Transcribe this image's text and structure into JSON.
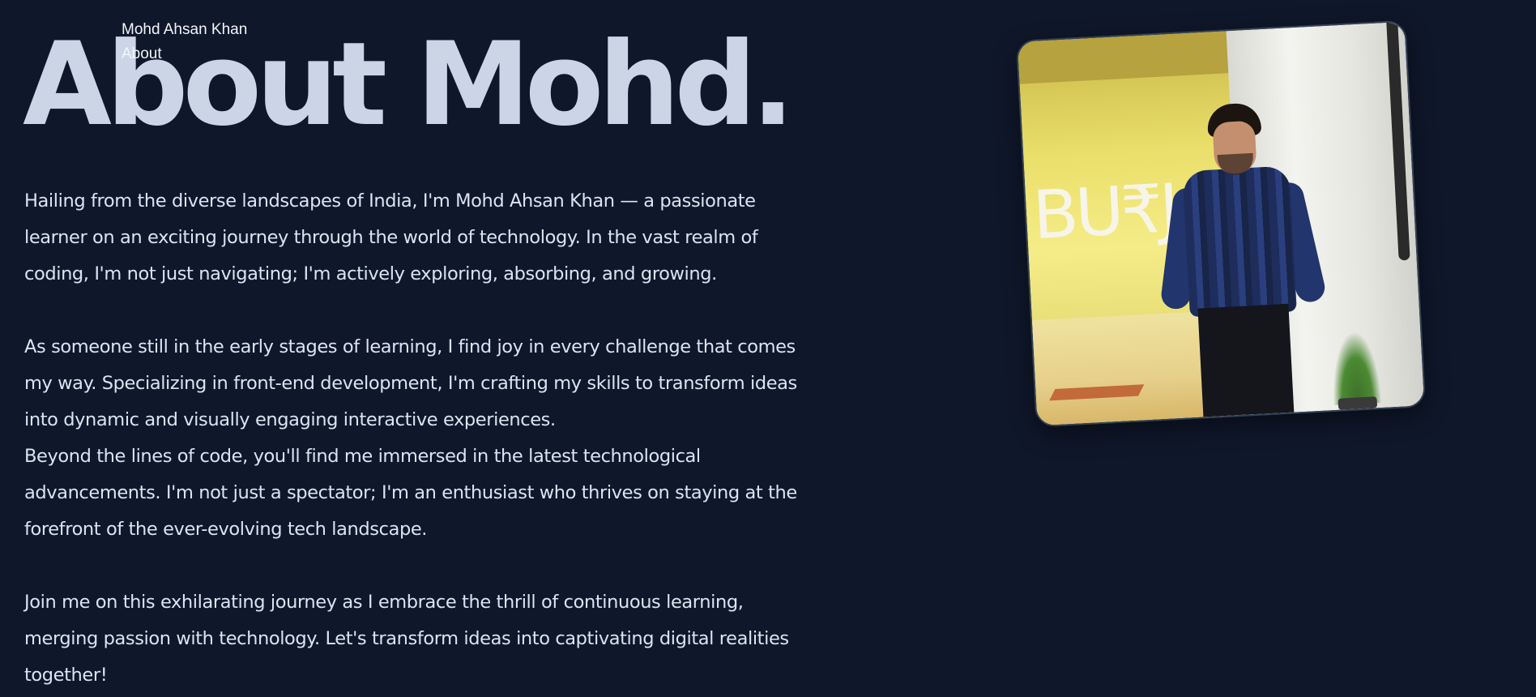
{
  "nav": {
    "brand": "Mohd Ahsan Khan",
    "link_about": "About"
  },
  "hero": {
    "title": "About Mohd."
  },
  "bio": {
    "paragraph_1": "Hailing from the diverse landscapes of India, I'm Mohd Ahsan Khan — a passionate learner on an exciting journey through the world of technology. In the vast realm of coding, I'm not just navigating; I'm actively exploring, absorbing, and growing.",
    "paragraph_2": "As someone still in the early stages of learning, I find joy in every challenge that comes my way. Specializing in front-end development, I'm crafting my skills to transform ideas into dynamic and visually engaging interactive experiences.",
    "paragraph_3": "Beyond the lines of code, you'll find me immersed in the latest technological advancements. I'm not just a spectator; I'm an enthusiast who thrives on staying at the forefront of the ever-evolving tech landscape.",
    "paragraph_4": " Join me on this exhilarating journey as I embrace the thrill of continuous learning, merging passion with technology. Let's transform ideas into captivating digital realities together!"
  },
  "photo": {
    "sign_text": "BU₹J"
  },
  "colors": {
    "background": "#0f172a",
    "hero_text": "#cbd5e6",
    "body_text": "#dbe4f0"
  }
}
